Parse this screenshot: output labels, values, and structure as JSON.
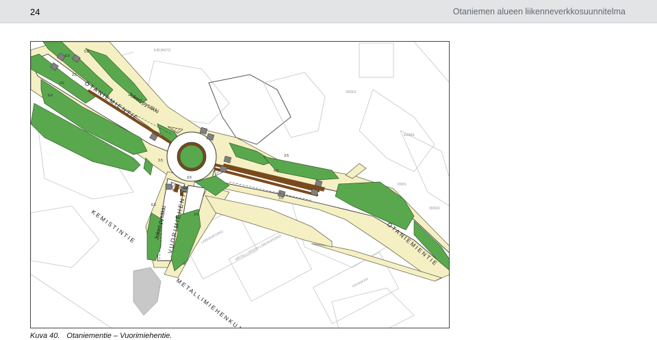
{
  "header": {
    "page_number": "24",
    "title": "Otaniemen alueen liikenneverkkosuunnitelma"
  },
  "map": {
    "streets": {
      "otaniemientie_north": "OTANIEMIENTIE",
      "otaniemientie_east": "OTANIEMIENTIE",
      "kemistintie": "KEMISTINTIE",
      "vuorimiehentie": "VUORIMIEHENTIE",
      "metallimiehenkuja": "METALLIMIEHENKUJA"
    },
    "stops": {
      "stop_north": "Jokeri-pysäkki",
      "stop_south": "Jokeri-pysäkki"
    },
    "dimensions": [
      "6.0",
      "5.0",
      "3.5",
      "3.5",
      "6.0",
      "3.5",
      "6.0",
      "3.5",
      "6.0",
      "3.5",
      "3.5",
      "3.5"
    ],
    "background_labels": [
      "KIRJASTO",
      "KEMIA",
      "LABORATORIO",
      "METALLURGIAN LABORATORIO",
      "TEKNIIKAN",
      "10001",
      "3MS01",
      "3MS02"
    ],
    "colors": {
      "green_area": "#5aa84e",
      "road_shoulder": "#f5f0c3",
      "tram_track": "#7a4a1c",
      "crossing": "#808080"
    }
  },
  "caption": {
    "figure_label": "Kuva 40.",
    "text": "Otaniementie – Vuorimiehentie."
  }
}
